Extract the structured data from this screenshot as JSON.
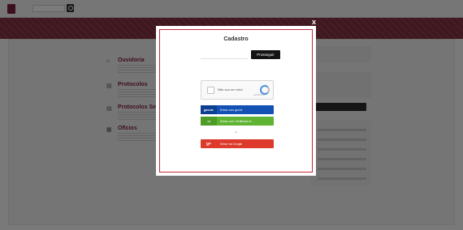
{
  "top": {
    "links": [
      "",
      "",
      "",
      ""
    ]
  },
  "content": {
    "breadcrumb": "",
    "services": [
      {
        "icon": "bank-icon",
        "title": "Ouvidoria"
      },
      {
        "icon": "document-icon",
        "title": "Protocolos"
      },
      {
        "icon": "document-icon",
        "title": "Protocolos Servi"
      },
      {
        "icon": "bar-chart-icon",
        "title": "Ofícios"
      }
    ],
    "footer": ""
  },
  "modal": {
    "title": "Cadastro",
    "subtitle": "",
    "cpf_placeholder": "",
    "prosseguir_label": "Prosseguir",
    "hints": [
      "",
      "",
      "",
      ""
    ],
    "captcha": {
      "label": "Não sou um robô",
      "brand": "reCAPTCHA"
    },
    "gov_badge": "gov.br",
    "gov_label": "Entrar com gov.br",
    "cert_badge": "",
    "cert_label": "Entrar com Certificado D...",
    "ou": "ou",
    "google_badge": "g+",
    "google_label": "Entrar via Google",
    "terms": [
      "",
      ""
    ],
    "close": "x"
  },
  "colors": {
    "brand": "#7a1f3a",
    "banner": "#84303f",
    "gov": "#1351b4",
    "cert": "#5fb332",
    "google": "#dd3a2c",
    "modal_border": "#c22a3c"
  }
}
